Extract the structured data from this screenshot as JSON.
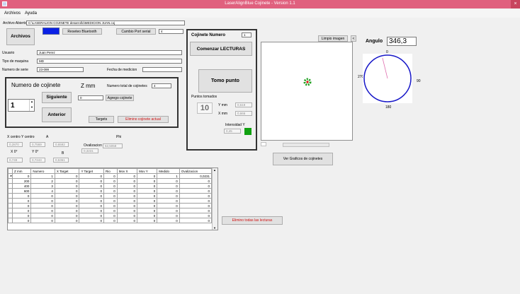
{
  "window": {
    "title": "LaserAlignBlue Cojinete - Version 1.1",
    "close_glyph": "×"
  },
  "menu": {
    "items": [
      "Archivos",
      "Ayuda"
    ]
  },
  "file": {
    "label": "Archivo Abierto",
    "path": "C:\\LASERALIGN COJINETE desarrollo\\MEDICION JUAN.coj",
    "open_button": "Archivos"
  },
  "bluetooth": {
    "reset_button": "Reseteo Bluetooth",
    "status_color": "#0a20e6",
    "serial_button": "Cambio Port serial",
    "serial_value": "4"
  },
  "info": {
    "user_label": "Usuario",
    "user_value": "Juan Perez",
    "machine_label": "Tipo de maquina",
    "machine_value": "MD",
    "serial_label": "Numero de serie",
    "serial_value": "23-099",
    "date_label": "Fecha de medicion",
    "date_value": ""
  },
  "bearing": {
    "title": "Numero de cojinete",
    "number": "1",
    "next_button": "Siguiente",
    "prev_button": "Anterior",
    "z_label": "Z mm",
    "z_value": "0",
    "total_label": "Numero total de cojinetes",
    "total_value": "4",
    "add_button": "Agrego cojinete",
    "targets_button": "Targets",
    "delete_button": "Elimino cojinete actual"
  },
  "reading": {
    "title": "Cojinete Numero",
    "number_value": "1",
    "start_button": "Comenzar LECTURAS",
    "point_button": "Tomo punto",
    "points_label": "Puntos tomados",
    "points_value": "10",
    "y_label": "Y mm",
    "y_value": "0,519",
    "x_label": "X mm",
    "x_value": "0,666",
    "intensity_label": "Intensidad Y",
    "intensity_value": "0,45",
    "intensity_color": "#10a010"
  },
  "image": {
    "clear_button": "Limpio imagen",
    "small_button": "<"
  },
  "angle": {
    "label": "Angulo",
    "value": "346,3",
    "deg": 346.3,
    "dial_top": "0",
    "dial_right": "90",
    "dial_bottom": "180",
    "dial_left": "270"
  },
  "center": {
    "headers": [
      "X centro",
      "Y centro",
      "A",
      "Ovalizacion",
      "Phi"
    ],
    "values": [
      "0,2870",
      "0,7569",
      "0,6592",
      "0,3231",
      "62,5058"
    ],
    "headers2": [
      "X 0°",
      "Y 0°",
      "B"
    ],
    "values2": [
      "0,749",
      "0,7243",
      "0,5361"
    ]
  },
  "charts_button": "Ver Graficos de cojinetes",
  "delete_all_button": "Elimino todas las lecturas",
  "table": {
    "headers": [
      "Z mm",
      "Numero",
      "X Target",
      "Y Target",
      "Rio",
      "Mov X",
      "Mov Y",
      "Medido",
      "Ovalizacion"
    ],
    "rows": [
      [
        "0",
        "1",
        "0",
        "0",
        "0",
        "0",
        "0",
        "1",
        "0,0231"
      ],
      [
        "200",
        "2",
        "0",
        "0",
        "0",
        "0",
        "0",
        "0",
        "0"
      ],
      [
        "400",
        "3",
        "0",
        "0",
        "0",
        "0",
        "0",
        "0",
        "0"
      ],
      [
        "600",
        "4",
        "0",
        "0",
        "0",
        "0",
        "0",
        "0",
        "0"
      ],
      [
        "0",
        "0",
        "0",
        "0",
        "0",
        "0",
        "0",
        "0",
        "0"
      ],
      [
        "0",
        "0",
        "0",
        "0",
        "0",
        "0",
        "0",
        "0",
        "0"
      ],
      [
        "0",
        "0",
        "0",
        "0",
        "0",
        "0",
        "0",
        "0",
        "0"
      ],
      [
        "0",
        "0",
        "0",
        "0",
        "0",
        "0",
        "0",
        "0",
        "0"
      ],
      [
        "0",
        "0",
        "0",
        "0",
        "0",
        "0",
        "0",
        "0",
        "0"
      ],
      [
        "0",
        "0",
        "0",
        "0",
        "0",
        "0",
        "0",
        "0",
        "0"
      ]
    ]
  }
}
